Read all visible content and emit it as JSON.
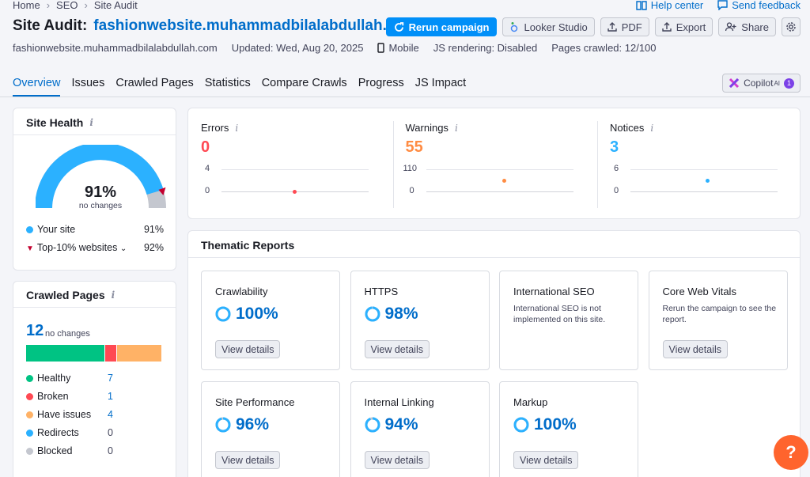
{
  "breadcrumb": [
    "Home",
    "SEO",
    "Site Audit"
  ],
  "header_links": {
    "help": "Help center",
    "feedback": "Send feedback"
  },
  "title": {
    "prefix": "Site Audit:",
    "domain": "fashionwebsite.muhammadbilalabdullah.com"
  },
  "toolbar": {
    "rerun": "Rerun campaign",
    "looker": "Looker Studio",
    "pdf": "PDF",
    "export": "Export",
    "share": "Share"
  },
  "meta": {
    "domain": "fashionwebsite.muhammadbilalabdullah.com",
    "updated": "Updated: Wed, Aug 20, 2025",
    "device": "Mobile",
    "js": "JS rendering: Disabled",
    "crawled": "Pages crawled: 12/100"
  },
  "tabs": [
    "Overview",
    "Issues",
    "Crawled Pages",
    "Statistics",
    "Compare Crawls",
    "Progress",
    "JS Impact"
  ],
  "copilot": {
    "label": "Copilot",
    "sup": "AI",
    "badge": "1"
  },
  "site_health": {
    "title": "Site Health",
    "score": "91%",
    "score_value": 0.91,
    "change": "no changes",
    "your_site_label": "Your site",
    "your_site_value": "91%",
    "top10_label": "Top-10% websites",
    "top10_value": "92%",
    "colors": {
      "your": "#2bb1ff",
      "top": "#c3002f",
      "track": "#c4c7cf"
    }
  },
  "crawled_pages": {
    "title": "Crawled Pages",
    "total": "12",
    "change": "no changes",
    "rows": [
      {
        "label": "Healthy",
        "value": "7",
        "color": "#00c383"
      },
      {
        "label": "Broken",
        "value": "1",
        "color": "#ff4953"
      },
      {
        "label": "Have issues",
        "value": "4",
        "color": "#ffb266"
      },
      {
        "label": "Redirects",
        "value": "0",
        "color": "#2bb1ff"
      },
      {
        "label": "Blocked",
        "value": "0",
        "color": "#c4c7cf"
      }
    ]
  },
  "counts": [
    {
      "label": "Errors",
      "value": "0",
      "color": "#ff4953",
      "axis_top": "4",
      "axis_bottom": "0"
    },
    {
      "label": "Warnings",
      "value": "55",
      "color": "#ff8c43",
      "axis_top": "110",
      "axis_bottom": "0"
    },
    {
      "label": "Notices",
      "value": "3",
      "color": "#2bb1ff",
      "axis_top": "6",
      "axis_bottom": "0"
    }
  ],
  "thematic": {
    "title": "Thematic Reports",
    "view_label": "View details",
    "tiles": [
      {
        "title": "Crawlability",
        "score": "100%",
        "value": 1.0
      },
      {
        "title": "HTTPS",
        "score": "98%",
        "value": 0.98
      },
      {
        "title": "International SEO",
        "desc": "International SEO is not implemented on this site."
      },
      {
        "title": "Core Web Vitals",
        "desc": "Rerun the campaign to see the report.",
        "view": true
      },
      {
        "title": "Site Performance",
        "score": "96%",
        "value": 0.96
      },
      {
        "title": "Internal Linking",
        "score": "94%",
        "value": 0.94
      },
      {
        "title": "Markup",
        "score": "100%",
        "value": 1.0
      }
    ]
  },
  "help_fab": "?"
}
